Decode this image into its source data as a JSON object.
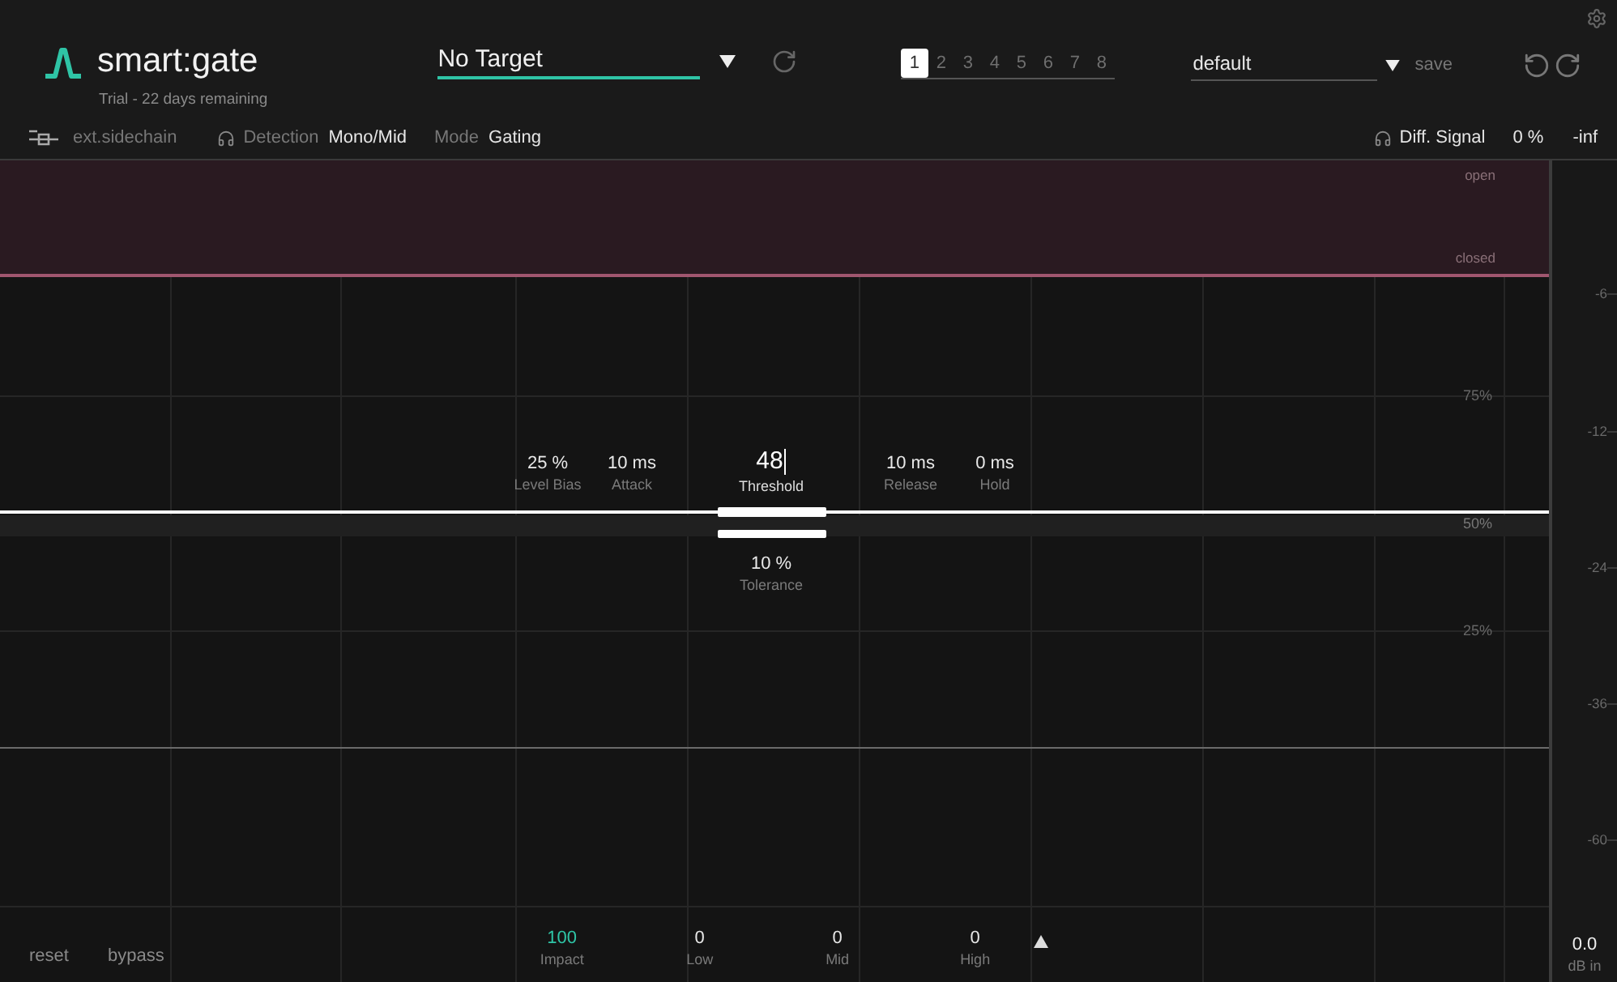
{
  "header": {
    "logo": "smart:gate",
    "trial": "Trial - 22 days remaining",
    "target": {
      "value": "No Target"
    },
    "slots": [
      {
        "label": "1",
        "selected": true
      },
      {
        "label": "2",
        "selected": false
      },
      {
        "label": "3",
        "selected": false
      },
      {
        "label": "4",
        "selected": false
      },
      {
        "label": "5",
        "selected": false
      },
      {
        "label": "6",
        "selected": false
      },
      {
        "label": "7",
        "selected": false
      },
      {
        "label": "8",
        "selected": false
      }
    ],
    "preset": {
      "value": "default"
    },
    "save": "save"
  },
  "toolbar": {
    "sidechain": "ext.sidechain",
    "detection": {
      "label": "Detection",
      "value": "Mono/Mid"
    },
    "mode": {
      "label": "Mode",
      "value": "Gating"
    },
    "diff_signal": "Diff. Signal",
    "diff_percent": "0 %",
    "diff_level": "-inf"
  },
  "graph": {
    "band": {
      "open": "open",
      "closed": "closed"
    },
    "percent_labels": [
      "75%",
      "50%",
      "25%"
    ],
    "params_left": [
      {
        "value": "25 %",
        "label": "Level Bias"
      },
      {
        "value": "10 ms",
        "label": "Attack"
      }
    ],
    "threshold": {
      "value": "48",
      "label": "Threshold"
    },
    "params_right": [
      {
        "value": "10 ms",
        "label": "Release"
      },
      {
        "value": "0 ms",
        "label": "Hold"
      }
    ],
    "tolerance": {
      "value": "10 %",
      "label": "Tolerance"
    }
  },
  "footer": {
    "reset": "reset",
    "bypass": "bypass",
    "knobs": [
      {
        "value": "100",
        "label": "Impact",
        "active": true
      },
      {
        "value": "0",
        "label": "Low",
        "active": false
      },
      {
        "value": "0",
        "label": "Mid",
        "active": false
      },
      {
        "value": "0",
        "label": "High",
        "active": false
      }
    ]
  },
  "meter": {
    "ticks": [
      "-6",
      "-12",
      "-24",
      "-36",
      "-60"
    ],
    "reading": "0.0",
    "unit": "dB in"
  }
}
